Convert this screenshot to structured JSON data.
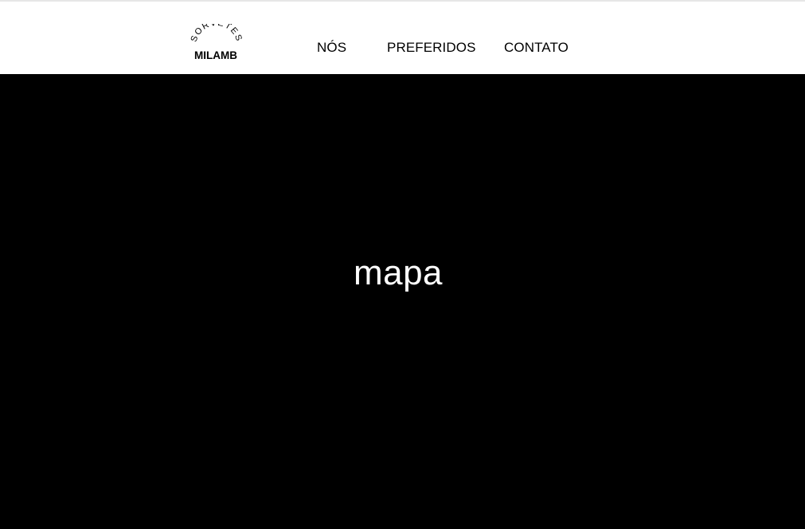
{
  "brand": {
    "arc_text": "SORVETES",
    "name": "MILAMB"
  },
  "nav": {
    "items": [
      "NÓS",
      "PREFERIDOS",
      "CONTATO"
    ]
  },
  "map": {
    "placeholder_text": "mapa"
  },
  "colors": {
    "header_bg": "#ffffff",
    "map_bg": "#000000",
    "nav_text": "#000000",
    "map_text": "#ffffff"
  }
}
